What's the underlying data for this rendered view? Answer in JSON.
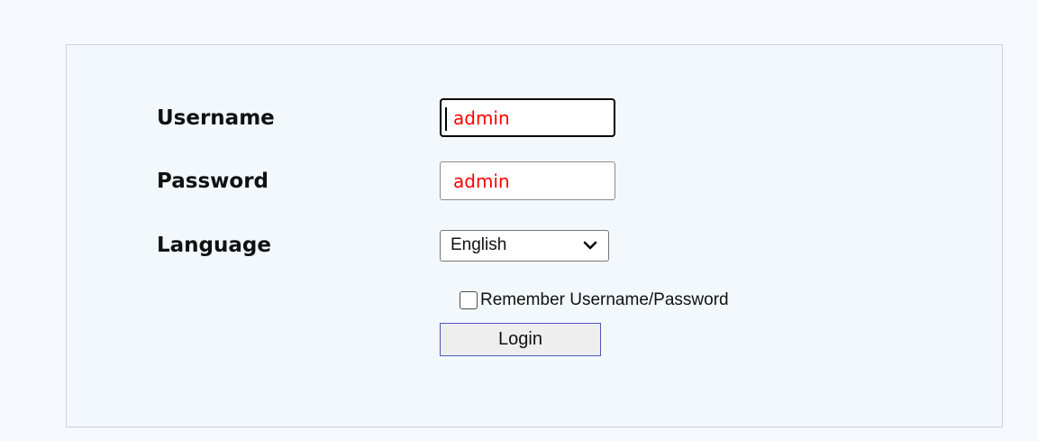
{
  "form": {
    "username_label": "Username",
    "username_value": "admin",
    "password_label": "Password",
    "password_value": "admin",
    "language_label": "Language",
    "language_selected": "English",
    "remember_label": "Remember Username/Password",
    "remember_checked": false,
    "login_label": "Login"
  },
  "colors": {
    "page_background": "#f5f9fd",
    "input_text": "#ff0000",
    "login_border": "#5059c0",
    "login_background": "#eeeeee"
  },
  "icons": {
    "language_dropdown": "chevron-down-icon"
  }
}
